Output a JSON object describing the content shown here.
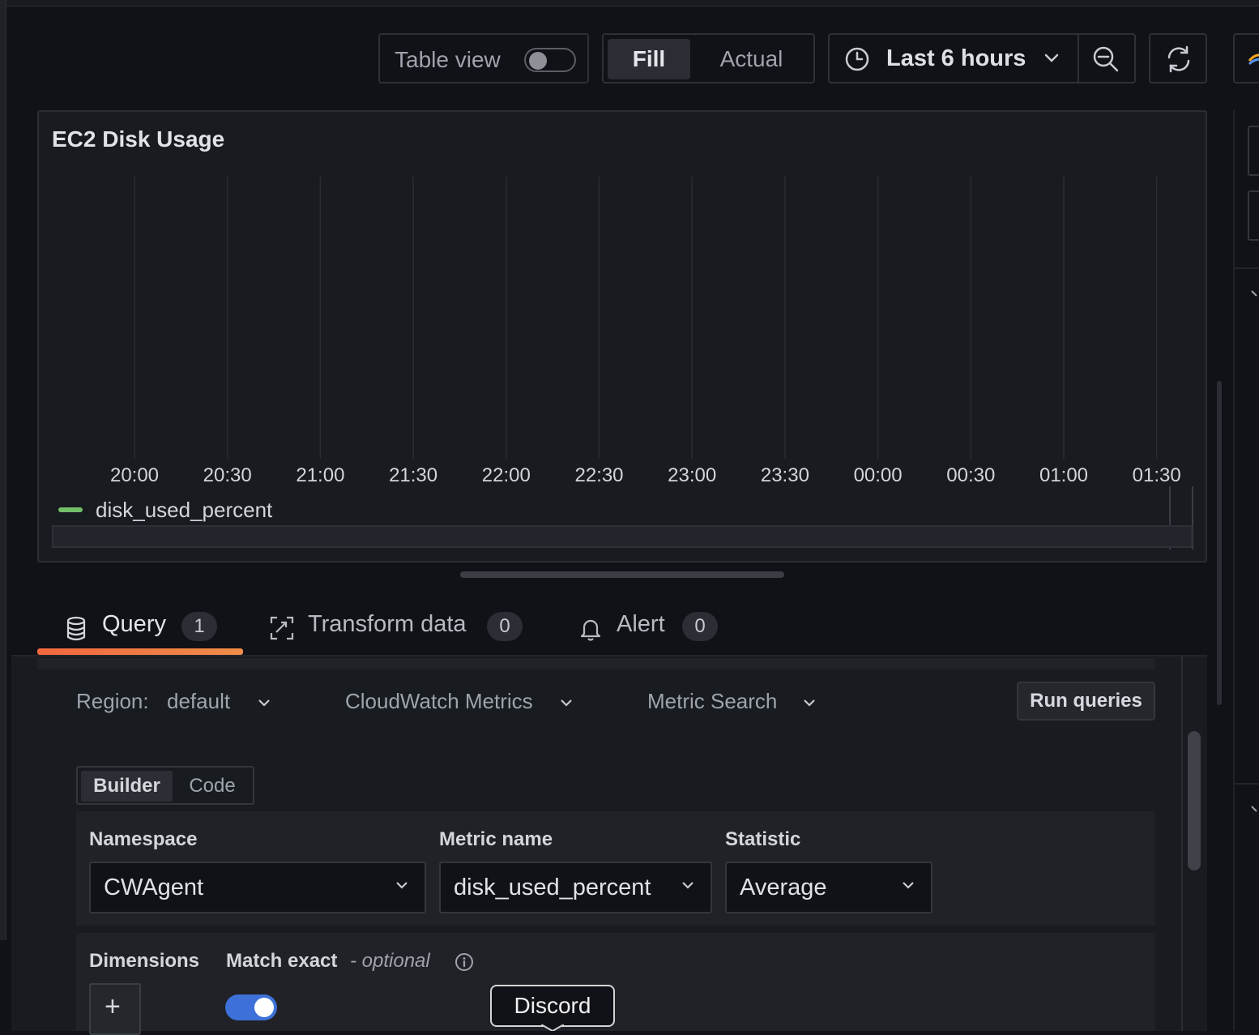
{
  "toolbar": {
    "table_view_label": "Table view",
    "table_view_enabled": false,
    "fill_label": "Fill",
    "actual_label": "Actual",
    "fill_mode_selected": "Fill",
    "time_range_label": "Last 6 hours",
    "icons": [
      "clock-icon",
      "chevron-down-icon",
      "zoom-out-icon",
      "refresh-icon"
    ]
  },
  "panel": {
    "title": "EC2 Disk Usage",
    "legend": [
      {
        "name": "disk_used_percent",
        "color": "#73bf69"
      }
    ]
  },
  "chart_data": {
    "type": "line",
    "title": "EC2 Disk Usage",
    "x_ticks": [
      "20:00",
      "20:30",
      "21:00",
      "21:30",
      "22:00",
      "22:30",
      "23:00",
      "23:30",
      "00:00",
      "00:30",
      "01:00",
      "01:30"
    ],
    "series": [
      {
        "name": "disk_used_percent",
        "color": "#73bf69",
        "values": []
      }
    ],
    "grid": true,
    "legend_position": "bottom-left"
  },
  "tabs": [
    {
      "label": "Query",
      "count": "1",
      "active": true,
      "icon": "database-icon"
    },
    {
      "label": "Transform data",
      "count": "0",
      "active": false,
      "icon": "transform-icon"
    },
    {
      "label": "Alert",
      "count": "0",
      "active": false,
      "icon": "bell-icon"
    }
  ],
  "query": {
    "region_label": "Region:",
    "region_value": "default",
    "service_value": "CloudWatch Metrics",
    "mode_value": "Metric Search",
    "run_button": "Run queries",
    "editor_modes": [
      "Builder",
      "Code"
    ],
    "editor_mode_selected": "Builder",
    "namespace_label": "Namespace",
    "namespace_value": "CWAgent",
    "metric_label": "Metric name",
    "metric_value": "disk_used_percent",
    "statistic_label": "Statistic",
    "statistic_value": "Average",
    "dimensions_label": "Dimensions",
    "match_exact_label": "Match exact",
    "optional_label": "- optional",
    "match_exact_enabled": true,
    "add_symbol": "+"
  },
  "tooltip": {
    "text": "Discord"
  },
  "colors": {
    "accent": "#f2673e",
    "toggle_on": "#3d71d9",
    "series": "#73bf69",
    "background": "#111217"
  }
}
